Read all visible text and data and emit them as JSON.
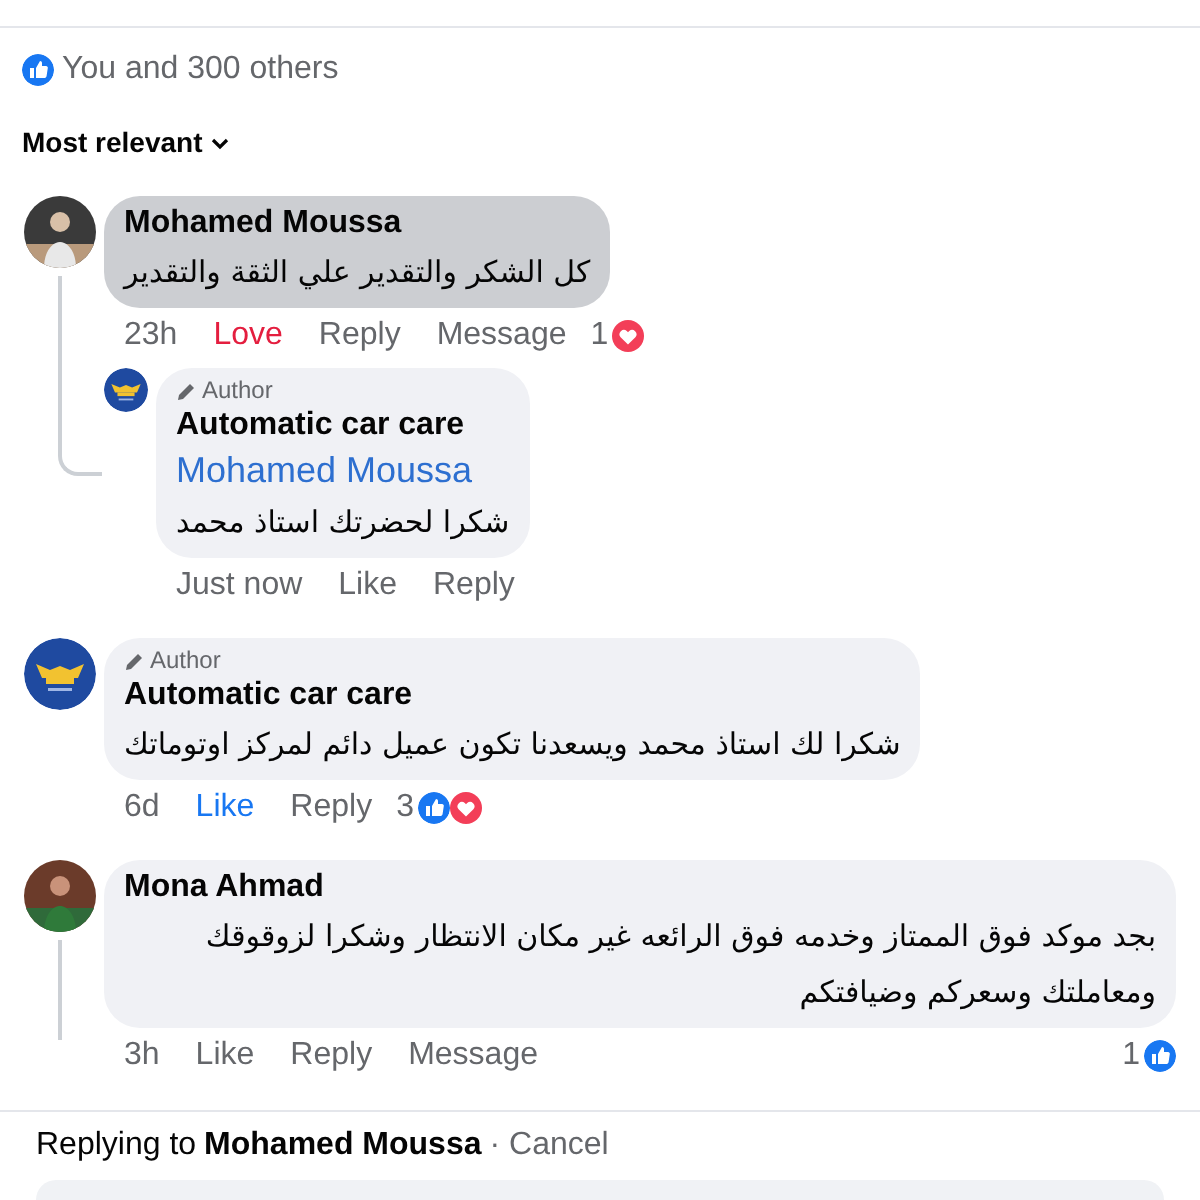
{
  "reactions_summary": {
    "text": "You and 300 others"
  },
  "sort": {
    "label": "Most relevant"
  },
  "comments": [
    {
      "avatar": {
        "kind": "picture"
      },
      "name": "Mohamed Moussa",
      "text": "كل الشكر والتقدير علي الثقة والتقدير",
      "time": "23h",
      "reaction": {
        "label": "Love",
        "kind": "love"
      },
      "reply_label": "Reply",
      "message_label": "Message",
      "count": "1",
      "icons": [
        {
          "kind": "love"
        }
      ],
      "replies": [
        {
          "avatar": {
            "kind": "logo"
          },
          "author_badge": "Author",
          "name": "Automatic car care",
          "mention": "Mohamed Moussa",
          "text": "شكرا لحضرتك استاذ محمد",
          "time": "Just now",
          "reaction": {
            "label": "Like",
            "kind": "none"
          },
          "reply_label": "Reply"
        }
      ]
    },
    {
      "avatar": {
        "kind": "logo"
      },
      "author_badge": "Author",
      "name": "Automatic car care",
      "text": "شكرا لك استاذ محمد ويسعدنا تكون عميل دائم لمركز اوتوماتك",
      "time": "6d",
      "reaction": {
        "label": "Like",
        "kind": "like"
      },
      "reply_label": "Reply",
      "count": "3",
      "icons": [
        {
          "kind": "like"
        },
        {
          "kind": "love"
        }
      ]
    },
    {
      "avatar": {
        "kind": "picture"
      },
      "name": "Mona Ahmad",
      "text": "بجد موكد فوق الممتاز  وخدمه فوق الرائعه غير مكان الانتظار وشكرا لزوقوقك ومعاملتك وسعركم  وضيافتكم",
      "time": "3h",
      "reaction": {
        "label": "Like",
        "kind": "none"
      },
      "reply_label": "Reply",
      "message_label": "Message",
      "count": "1",
      "icons": [
        {
          "kind": "like"
        }
      ]
    }
  ],
  "reply_bar": {
    "prefix": "Replying to",
    "name": "Mohamed Moussa",
    "cancel": "· Cancel"
  }
}
